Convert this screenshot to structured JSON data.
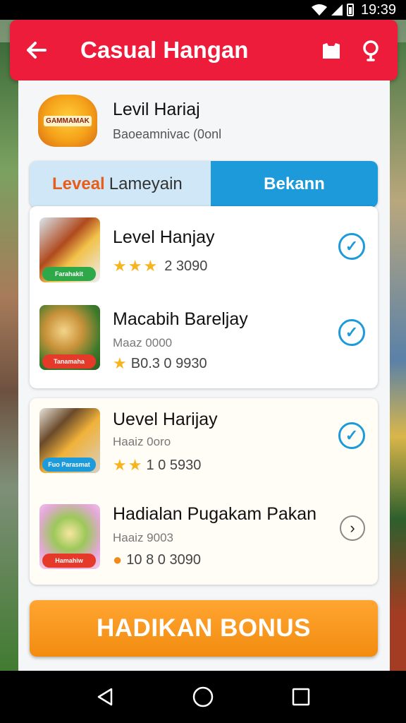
{
  "status_bar": {
    "time": "19:39"
  },
  "app_bar": {
    "title": "Casual Hangan"
  },
  "store": {
    "name": "Levil Hariaj",
    "subtitle": "Baoeamnivac (0onl",
    "logo_text": "GAMMAMAK"
  },
  "tabs": {
    "tab1_highlight": "Leveal",
    "tab1_rest": "Lameyain",
    "tab2": "Bekann"
  },
  "items": [
    {
      "name": "Level Hanjay",
      "sub": "",
      "rating_text": "2 3090",
      "stars": 3,
      "badge": "Farahakit",
      "badge_color": "#2fa84a",
      "action": "check"
    },
    {
      "name": "Macabih Bareljay",
      "sub": "Maaz 0000",
      "rating_text": "B0.3 0 9930",
      "stars": 1,
      "badge": "Tanamaha",
      "badge_color": "#e53a2a",
      "action": "check"
    },
    {
      "name": "Uevel Harijay",
      "sub": "Haaiz 0oro",
      "rating_text": "1 0 5930",
      "stars": 2,
      "badge": "Fuo Parasmat",
      "badge_color": "#1d9ad9",
      "action": "check"
    },
    {
      "name": "Hadialan Pugakam Pakan",
      "sub": "Haaiz 9003",
      "rating_text": "10 8 0 3090",
      "stars": 1,
      "badge": "Hamahiw",
      "badge_color": "#e53a2a",
      "action": "chevron"
    }
  ],
  "cta": {
    "label": "HADIKAN BONUS"
  },
  "colors": {
    "primary_red": "#ee1c3b",
    "accent_blue": "#1d9ad9",
    "cta_orange": "#f28c10"
  }
}
